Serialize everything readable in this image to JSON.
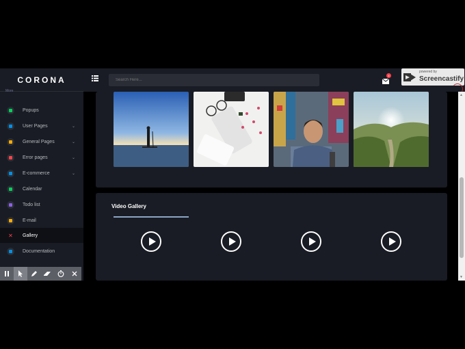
{
  "brand": "CORONA",
  "sidebar": {
    "section_label": "More",
    "items": [
      {
        "label": "Popups",
        "icon": "popup-icon",
        "color": "#00d25b",
        "chevron": ""
      },
      {
        "label": "User Pages",
        "icon": "user-icon",
        "color": "#0090e7",
        "chevron": "⌄"
      },
      {
        "label": "General Pages",
        "icon": "globe-icon",
        "color": "#ffab00",
        "chevron": "⌄"
      },
      {
        "label": "Error pages",
        "icon": "lock-icon",
        "color": "#fc424a",
        "chevron": "⌄"
      },
      {
        "label": "E-commerce",
        "icon": "cart-icon",
        "color": "#0090e7",
        "chevron": "⌄"
      },
      {
        "label": "Calendar",
        "icon": "calendar-icon",
        "color": "#00d25b",
        "chevron": ""
      },
      {
        "label": "Todo list",
        "icon": "checklist-icon",
        "color": "#8f5fe8",
        "chevron": ""
      },
      {
        "label": "E-mail",
        "icon": "email-icon",
        "color": "#ffab00",
        "chevron": ""
      },
      {
        "label": "Gallery",
        "icon": "gallery-icon",
        "color": "#fc424a",
        "chevron": ""
      },
      {
        "label": "Documentation",
        "icon": "doc-icon",
        "color": "#0090e7",
        "chevron": ""
      }
    ]
  },
  "topbar": {
    "search_placeholder": "Search Here...",
    "mail_badge": "4"
  },
  "screencastify": {
    "powered": "powered by",
    "name": "Screencastify"
  },
  "video_gallery": {
    "title": "Video Gallery"
  },
  "recorder": {
    "tools": [
      "pause-icon",
      "cursor-icon",
      "pen-icon",
      "eraser-icon",
      "timer-icon",
      "close-icon"
    ]
  }
}
